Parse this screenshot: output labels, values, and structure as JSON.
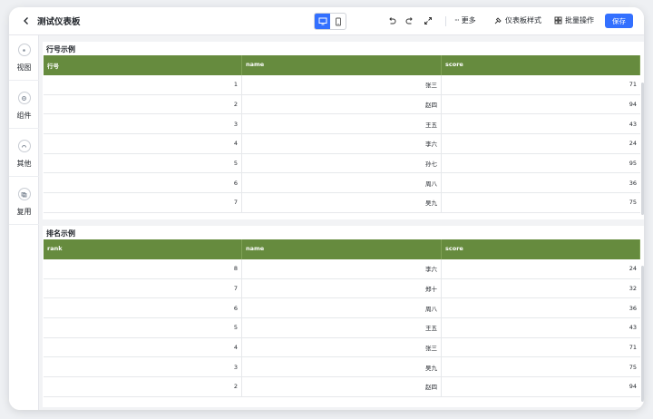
{
  "header": {
    "title": "测试仪表板",
    "more_label": "更多",
    "style_label": "仪表板样式",
    "batch_label": "批量操作",
    "save_label": "保存"
  },
  "sidebar": {
    "items": [
      {
        "label": "视图",
        "icon": "view-icon"
      },
      {
        "label": "组件",
        "icon": "component-icon"
      },
      {
        "label": "其他",
        "icon": "other-icon"
      },
      {
        "label": "复用",
        "icon": "reuse-icon"
      }
    ]
  },
  "tables": [
    {
      "title": "行号示例",
      "columns": [
        "行号",
        "name",
        "score"
      ],
      "rows": [
        [
          "1",
          "张三",
          "71"
        ],
        [
          "2",
          "赵四",
          "94"
        ],
        [
          "3",
          "王五",
          "43"
        ],
        [
          "4",
          "李六",
          "24"
        ],
        [
          "5",
          "孙七",
          "95"
        ],
        [
          "6",
          "周八",
          "36"
        ],
        [
          "7",
          "吴九",
          "75"
        ]
      ]
    },
    {
      "title": "排名示例",
      "columns": [
        "rank",
        "name",
        "score"
      ],
      "rows": [
        [
          "8",
          "李六",
          "24"
        ],
        [
          "7",
          "郑十",
          "32"
        ],
        [
          "6",
          "周八",
          "36"
        ],
        [
          "5",
          "王五",
          "43"
        ],
        [
          "4",
          "张三",
          "71"
        ],
        [
          "3",
          "吴九",
          "75"
        ],
        [
          "2",
          "赵四",
          "94"
        ]
      ]
    }
  ],
  "colors": {
    "accent": "#3370ff",
    "table_header": "#668b3e"
  }
}
